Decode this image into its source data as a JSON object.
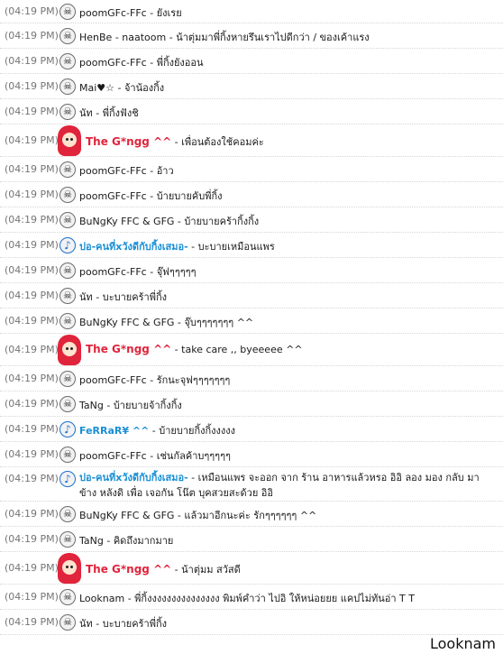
{
  "messages": [
    {
      "time": "(04:19 PM)",
      "name": "poomGFc-FFc",
      "text": "ยังเรย",
      "avatar": "skull-icon",
      "name_style": "normal"
    },
    {
      "time": "(04:19 PM)",
      "name": "HenBe - naatoom",
      "text": "น้าตุ่มมาพี่กิ้งหายรึนเราไปดีกว่า / ของเค้าแรง",
      "avatar": "skull-icon",
      "name_style": "normal"
    },
    {
      "time": "(04:19 PM)",
      "name": "poomGFc-FFc",
      "text": "พี่กิ้งยังออน",
      "avatar": "skull-icon",
      "name_style": "normal"
    },
    {
      "time": "(04:19 PM)",
      "name": "Mai♥☆",
      "text": "จ้าน้องกิ้ง",
      "avatar": "skull-icon",
      "name_style": "normal"
    },
    {
      "time": "(04:19 PM)",
      "name": "นัท",
      "text": "พี่กิ้งฟังชิ",
      "avatar": "skull-icon",
      "name_style": "normal"
    },
    {
      "time": "(04:19 PM)",
      "name": "The G*ngg ^^",
      "text": "เพื่อนต้องใช้คอมค่ะ",
      "avatar": "girl-avatar-icon",
      "name_style": "red"
    },
    {
      "time": "(04:19 PM)",
      "name": "poomGFc-FFc",
      "text": "อ้าว",
      "avatar": "skull-icon",
      "name_style": "normal"
    },
    {
      "time": "(04:19 PM)",
      "name": "poomGFc-FFc",
      "text": "บ้ายบายคับพี่กิ้ง",
      "avatar": "skull-icon",
      "name_style": "normal"
    },
    {
      "time": "(04:19 PM)",
      "name": "BuNgKy FFC & GFG",
      "text": "บ้ายบายคร้ากิ้งกิ้ง",
      "avatar": "skull-icon",
      "name_style": "normal"
    },
    {
      "time": "(04:19 PM)",
      "name": "ปอ-คนที่xวังดีกับกิ้งเสมอ-",
      "text": "บะบายเหมือนแพร",
      "avatar": "music-note-icon",
      "name_style": "blue"
    },
    {
      "time": "(04:19 PM)",
      "name": "poomGFc-FFc",
      "text": "จุ๊ฟๆๆๆๆๆ",
      "avatar": "skull-icon",
      "name_style": "normal"
    },
    {
      "time": "(04:19 PM)",
      "name": "นัท",
      "text": "บะบายคร้าพี่กิ้ง",
      "avatar": "skull-icon",
      "name_style": "normal"
    },
    {
      "time": "(04:19 PM)",
      "name": "BuNgKy FFC & GFG",
      "text": "จุ๊บๆๆๆๆๆๆๆ ^^",
      "avatar": "skull-icon",
      "name_style": "normal"
    },
    {
      "time": "(04:19 PM)",
      "name": "The G*ngg ^^",
      "text": "take care ,, byeeeee ^^",
      "avatar": "girl-avatar-icon",
      "name_style": "red"
    },
    {
      "time": "(04:19 PM)",
      "name": "poomGFc-FFc",
      "text": "รักนะจุฟๆๆๆๆๆๆๆ",
      "avatar": "skull-icon",
      "name_style": "normal"
    },
    {
      "time": "(04:19 PM)",
      "name": "TaNg",
      "text": "บ้ายบายจ้ากิ้งกิ้ง",
      "avatar": "skull-icon",
      "name_style": "normal"
    },
    {
      "time": "(04:19 PM)",
      "name": "FeRRaR¥ ^^",
      "text": "บ้ายบายกิ้งกิ้งงงงง",
      "avatar": "music-note-icon",
      "name_style": "blue"
    },
    {
      "time": "(04:19 PM)",
      "name": "poomGFc-FFc",
      "text": "เช่นกัลค้าบๆๆๆๆๆ",
      "avatar": "skull-icon",
      "name_style": "normal"
    },
    {
      "time": "(04:19 PM)",
      "name": "ปอ-คนที่xวังดีกับกิ้งเสมอ-",
      "text": "เหมือนแพร จะออก จาก ร้าน อาหารแล้วหรอ อิอิ ลอง มอง กลับ มา ข้าง หลังดิ เพื่อ เจอกัน โน๊ต บุคสวยสะด้วย อิอิ",
      "avatar": "music-note-icon",
      "name_style": "blue"
    },
    {
      "time": "(04:19 PM)",
      "name": "BuNgKy FFC & GFG",
      "text": "แล้วมาอีกนะค่ะ รักๆๆๆๆๆๆ ^^",
      "avatar": "skull-icon",
      "name_style": "normal"
    },
    {
      "time": "(04:19 PM)",
      "name": "TaNg",
      "text": "คิดถึงมากมาย",
      "avatar": "skull-icon",
      "name_style": "normal"
    },
    {
      "time": "(04:19 PM)",
      "name": "The G*ngg ^^",
      "text": "น้าตุ่มม สวัสดี",
      "avatar": "girl-avatar-icon",
      "name_style": "red"
    },
    {
      "time": "(04:19 PM)",
      "name": "Looknam",
      "text": "พี่กิ้งงงงงงงงงงงงงงง พิมพ์คำว่า ไปอิ ให้หน่อยยย แคปไม่ทันอ่า T T",
      "avatar": "skull-icon",
      "name_style": "normal"
    },
    {
      "time": "(04:19 PM)",
      "name": "นัท",
      "text": "บะบายคร้าพี่กิ้ง",
      "avatar": "skull-icon",
      "name_style": "normal"
    }
  ],
  "watermark": "Looknam"
}
